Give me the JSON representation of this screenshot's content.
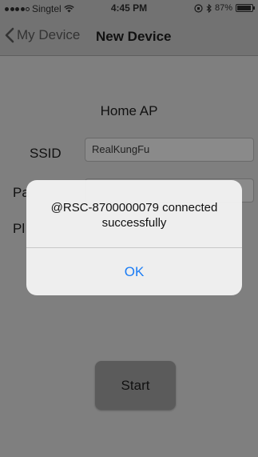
{
  "status_bar": {
    "carrier": "Singtel",
    "time": "4:45 PM",
    "battery_percent": "87%"
  },
  "nav": {
    "back_label": "My Device",
    "title": "New Device"
  },
  "form": {
    "section_title": "Home AP",
    "ssid_label": "SSID",
    "ssid_value": "RealKungFu",
    "password_label_visible": "Pa",
    "ph_label_visible": "Pl"
  },
  "start_label": "Start",
  "alert": {
    "message": "@RSC-8700000079 connected successfully",
    "ok_label": "OK"
  }
}
